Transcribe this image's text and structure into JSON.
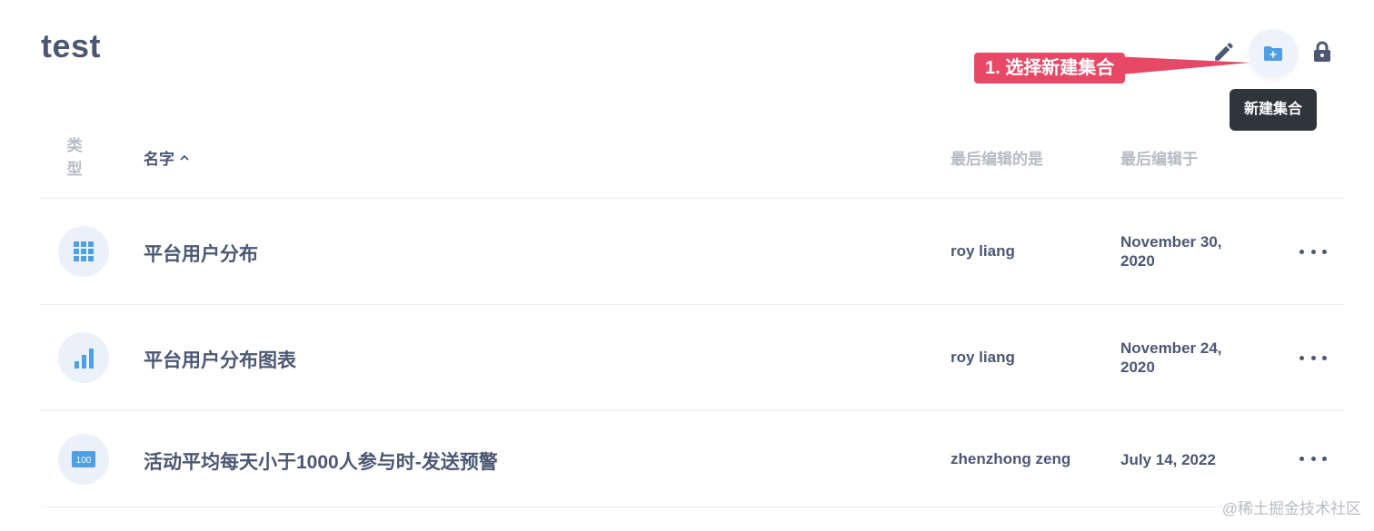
{
  "collection": {
    "title": "test"
  },
  "toolbar": {
    "edit_icon": "pencil-icon",
    "new_collection_icon": "folder-plus-icon",
    "lock_icon": "lock-icon",
    "new_collection_tooltip": "新建集合"
  },
  "annotation": {
    "callout_text": "1. 选择新建集合",
    "color": "#e64866"
  },
  "table": {
    "headers": {
      "type": "类型",
      "name": "名字",
      "last_edited_by": "最后编辑的是",
      "last_edited_at": "最后编辑于"
    },
    "sort_indicator": "chevron-up-icon",
    "rows": [
      {
        "type_icon": "table-grid-icon",
        "name": "平台用户分布",
        "editor": "roy liang",
        "date": "November 30, 2020"
      },
      {
        "type_icon": "bar-chart-icon",
        "name": "平台用户分布图表",
        "editor": "roy liang",
        "date": "November 24, 2020"
      },
      {
        "type_icon": "number-icon",
        "type_icon_text": "100",
        "name": "活动平均每天小于1000人参与时-发送预警",
        "editor": "zhenzhong zeng",
        "date": "July 14, 2022"
      }
    ]
  },
  "watermark": "@稀土掘金技术社区",
  "colors": {
    "text": "#4c5773",
    "muted": "#b8bbc3",
    "accent": "#509ee3",
    "tooltip_bg": "#2e353b"
  }
}
